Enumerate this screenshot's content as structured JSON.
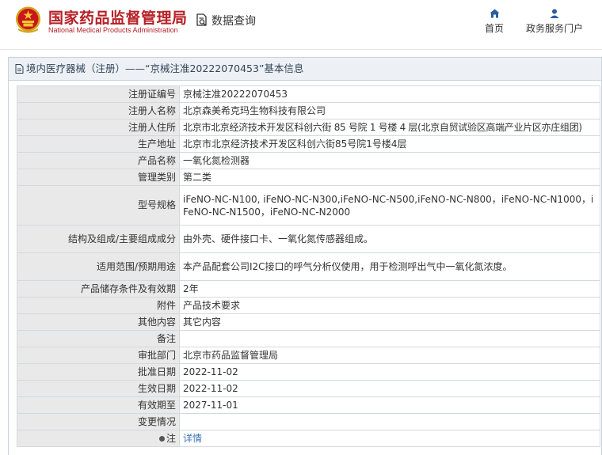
{
  "header": {
    "site_name_cn": "国家药品监督管理局",
    "site_name_en": "National Medical Products Administration",
    "query_label": "数据查询",
    "nav_home": "首页",
    "nav_service": "政务服务门户"
  },
  "panel": {
    "title": "境内医疗器械（注册）——“京械注准20222070453”基本信息"
  },
  "rows": [
    {
      "label": "注册证编号",
      "value": "京械注准20222070453"
    },
    {
      "label": "注册人名称",
      "value": "北京森美希克玛生物科技有限公司"
    },
    {
      "label": "注册人住所",
      "value": "北京市北京经济技术开发区科创六街 85 号院 1 号楼 4 层(北京自贸试验区高端产业片区亦庄组团)"
    },
    {
      "label": "生产地址",
      "value": "北京市北京经济技术开发区科创六街85号院1号楼4层"
    },
    {
      "label": "产品名称",
      "value": "一氧化氮检测器"
    },
    {
      "label": "管理类别",
      "value": "第二类"
    },
    {
      "label": "型号规格",
      "value": "iFeNO-NC-N100, iFeNO-NC-N300,iFeNO-NC-N500,iFeNO-NC-N800，iFeNO-NC-N1000，iFeNO-NC-N1500，iFeNO-NC-N2000"
    },
    {
      "label": "结构及组成/主要组成成分",
      "value": "由外壳、硬件接口卡、一氧化氮传感器组成。"
    },
    {
      "label": "适用范围/预期用途",
      "value": "本产品配套公司I2C接口的呼气分析仪使用，用于检测呼出气中一氧化氮浓度。"
    },
    {
      "label": "产品储存条件及有效期",
      "value": "2年"
    },
    {
      "label": "附件",
      "value": "产品技术要求"
    },
    {
      "label": "其他内容",
      "value": "其它内容"
    },
    {
      "label": "备注",
      "value": ""
    },
    {
      "label": "审批部门",
      "value": "北京市药品监督管理局"
    },
    {
      "label": "批准日期",
      "value": "2022-11-02"
    },
    {
      "label": "生效日期",
      "value": "2022-11-02"
    },
    {
      "label": "有效期至",
      "value": "2027-11-01"
    },
    {
      "label": "变更情况",
      "value": ""
    },
    {
      "label": "注",
      "value": "详情"
    }
  ]
}
